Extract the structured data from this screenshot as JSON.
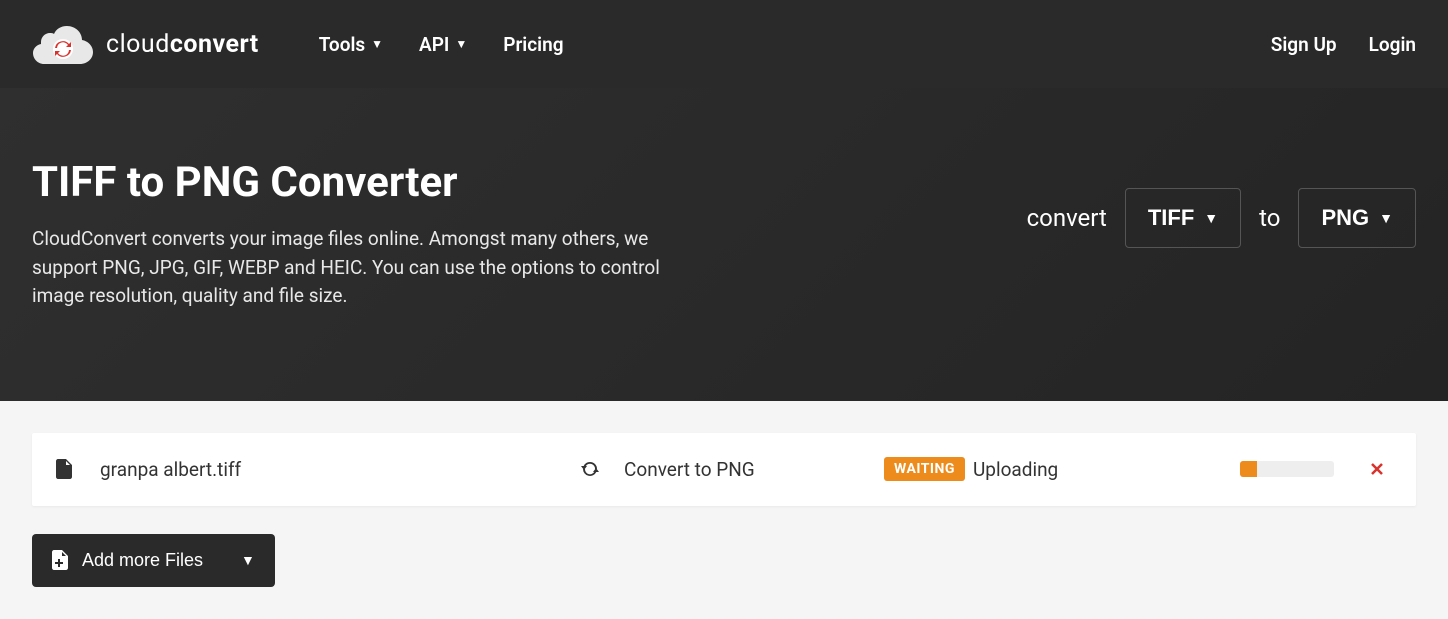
{
  "brand": {
    "name_light": "cloud",
    "name_bold": "convert"
  },
  "nav": {
    "tools": "Tools",
    "api": "API",
    "pricing": "Pricing",
    "signup": "Sign Up",
    "login": "Login"
  },
  "hero": {
    "title": "TIFF to PNG Converter",
    "desc": "CloudConvert converts your image files online. Amongst many others, we support PNG, JPG, GIF, WEBP and HEIC. You can use the options to control image resolution, quality and file size."
  },
  "convert": {
    "label_from": "convert",
    "from": "TIFF",
    "label_to": "to",
    "to": "PNG"
  },
  "file": {
    "name": "granpa albert.tiff",
    "action": "Convert to PNG",
    "status_badge": "WAITING",
    "status_text": "Uploading"
  },
  "add_more": "Add more Files"
}
